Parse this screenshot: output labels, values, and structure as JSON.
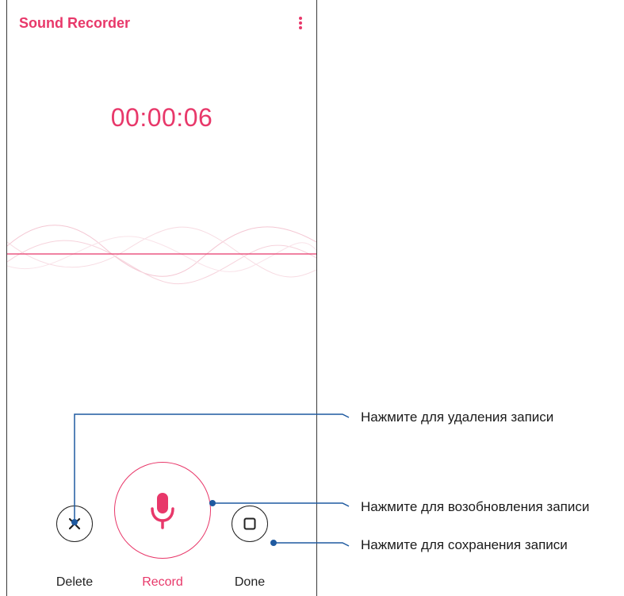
{
  "app": {
    "title": "Sound Recorder",
    "menu_icon": "more-vertical-icon"
  },
  "recorder": {
    "timer": "00:00:06",
    "state": "recording"
  },
  "controls": {
    "delete": {
      "label": "Delete",
      "icon": "close-icon"
    },
    "record": {
      "label": "Record",
      "icon": "microphone-icon"
    },
    "done": {
      "label": "Done",
      "icon": "stop-square-icon"
    }
  },
  "callouts": [
    {
      "text": "Нажмите для удаления записи",
      "target": "delete"
    },
    {
      "text": "Нажмите для возобновления записи",
      "target": "record"
    },
    {
      "text": "Нажмите для сохранения записи",
      "target": "done"
    }
  ],
  "colors": {
    "accent": "#e8386a",
    "callout_line": "#1f5aa0",
    "text": "#222222"
  }
}
